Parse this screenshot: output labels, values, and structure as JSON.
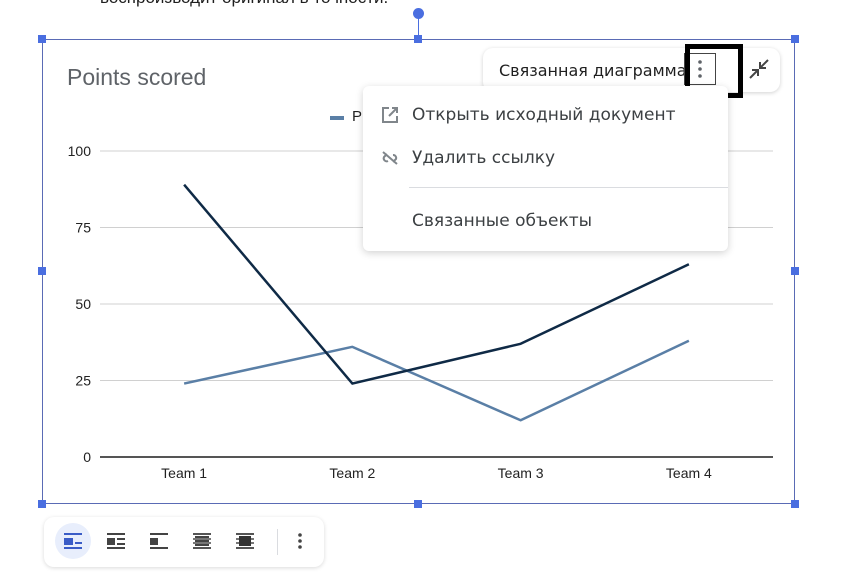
{
  "document": {
    "text_line": "воспроизводит оригинал в точности."
  },
  "chart_widget": {
    "linked_chip_label": "Связанная диаграмма",
    "more_icon": "more-vertical-icon",
    "collapse_icon": "collapse-icon"
  },
  "menu": {
    "items": [
      {
        "label": "Открыть исходный документ",
        "icon": "open-external-icon"
      },
      {
        "label": "Удалить ссылку",
        "icon": "unlink-icon"
      },
      {
        "label": "Связанные объекты",
        "icon": ""
      }
    ]
  },
  "toolbar": {
    "buttons": [
      {
        "name": "inline",
        "active": true
      },
      {
        "name": "wrap-text",
        "active": false
      },
      {
        "name": "break-text",
        "active": false
      },
      {
        "name": "behind-text",
        "active": false
      },
      {
        "name": "in-front-of-text",
        "active": false
      }
    ],
    "more_icon": "more-vertical-icon"
  },
  "colors": {
    "selection": "#4a6ee0",
    "series_dark": "#0f2a46",
    "series_light": "#5a7fa6",
    "active_button_bg": "#e8eefc"
  },
  "chart_data": {
    "type": "line",
    "title": "Points scored",
    "categories": [
      "Team 1",
      "Team 2",
      "Team 3",
      "Team 4"
    ],
    "series": [
      {
        "name": "P",
        "values": [
          24,
          36,
          12,
          38
        ],
        "color": "#5a7fa6"
      },
      {
        "name": "",
        "values": [
          89,
          24,
          37,
          63
        ],
        "color": "#0f2a46"
      }
    ],
    "legend_visible_text": "P",
    "legend": "top",
    "xlabel": "",
    "ylabel": "",
    "ylim": [
      0,
      100
    ],
    "yticks": [
      0,
      25,
      50,
      75,
      100
    ],
    "grid": true
  }
}
